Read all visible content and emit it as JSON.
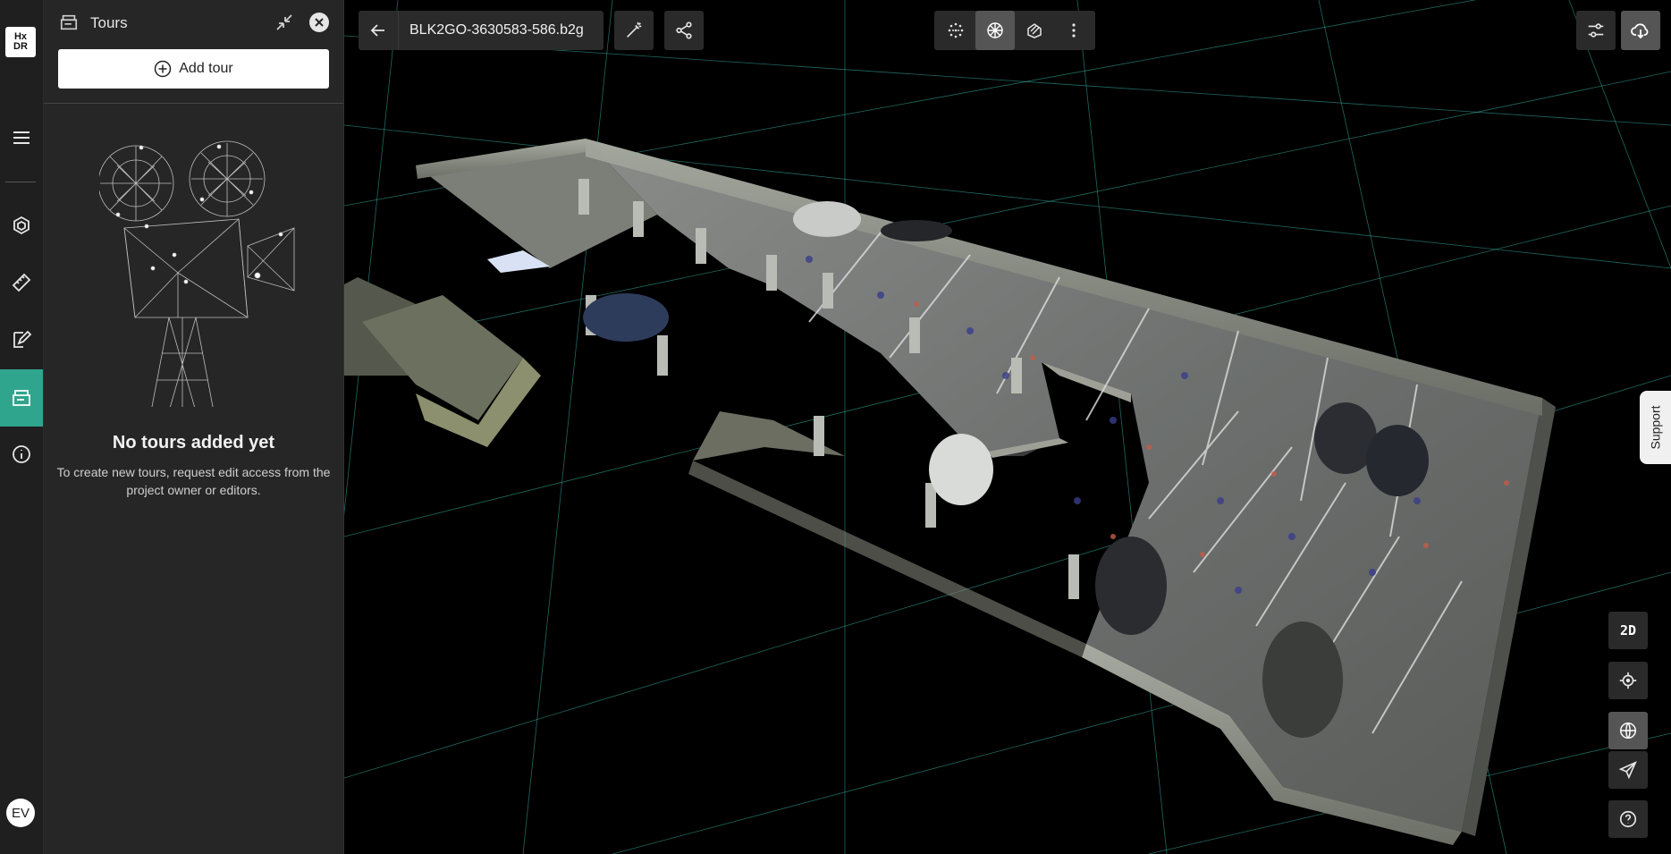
{
  "logo": {
    "line1": "Hx",
    "line2": "DR"
  },
  "rail": {
    "items": [
      {
        "name": "menu",
        "icon": "menu-icon"
      },
      {
        "name": "3d-objects",
        "icon": "cube-icon"
      },
      {
        "name": "measure",
        "icon": "ruler-icon"
      },
      {
        "name": "annotate",
        "icon": "edit-icon"
      },
      {
        "name": "tours",
        "icon": "tours-icon",
        "active": true
      },
      {
        "name": "info",
        "icon": "info-icon"
      }
    ],
    "avatar_initials": "EV"
  },
  "panel": {
    "title": "Tours",
    "add_button_label": "Add tour",
    "empty_title": "No tours added yet",
    "empty_text": "To create new tours, request edit access from the project owner or editors."
  },
  "topbar": {
    "file_name": "BLK2GO-3630583-586.b2g",
    "view_modes": [
      "point-cloud-icon",
      "mesh-icon",
      "texture-icon",
      "more-icon"
    ],
    "selected_view_mode": "mesh-icon"
  },
  "side_controls": {
    "mode_2d_label": "2D",
    "support_label": "Support"
  },
  "colors": {
    "accent": "#2fa58d",
    "grid": "#3fd0c0"
  }
}
